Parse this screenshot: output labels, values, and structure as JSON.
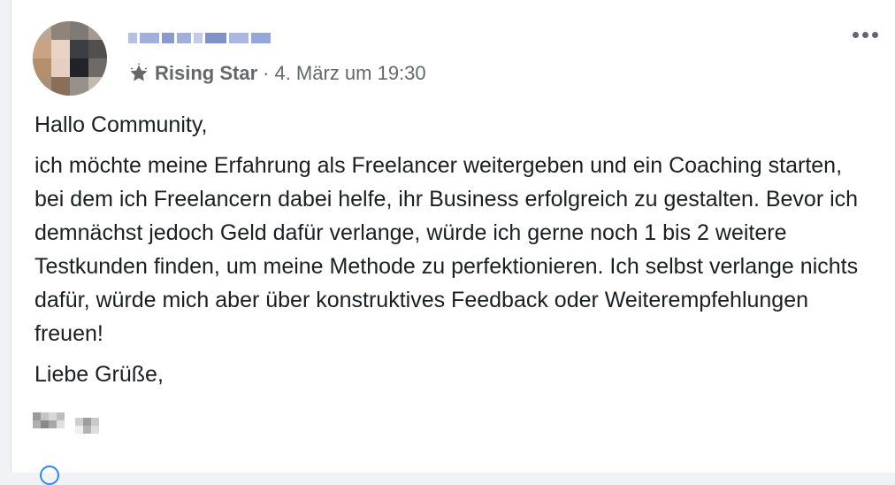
{
  "post": {
    "author": {
      "avatar_icon": "blurred-profile-photo",
      "name_icon": "blurred-author-name"
    },
    "badge": {
      "icon": "star-icon",
      "label": "Rising Star"
    },
    "separator": "·",
    "timestamp": "4. März um 19:30",
    "more_icon": "more-options-icon",
    "body": {
      "greeting": "Hallo Community,",
      "paragraph": "ich möchte meine Erfahrung als Freelancer weitergeben und ein Coaching starten, bei dem ich Freelancern dabei helfe, ihr Business erfolgreich zu gestalten. Bevor ich demnächst jedoch Geld dafür verlange, würde ich gerne noch 1 bis 2 weitere Testkunden finden, um meine Methode zu perfektionieren. Ich selbst verlange nichts dafür, würde mich aber über konstruktives Feedback oder Weiterempfehlungen freuen!",
      "closing": "Liebe Grüße,"
    },
    "signature_icon": "blurred-signature"
  },
  "colors": {
    "text": "#1c1e21",
    "meta": "#65676b",
    "accent": "#2d88ff",
    "background": "#ffffff"
  }
}
